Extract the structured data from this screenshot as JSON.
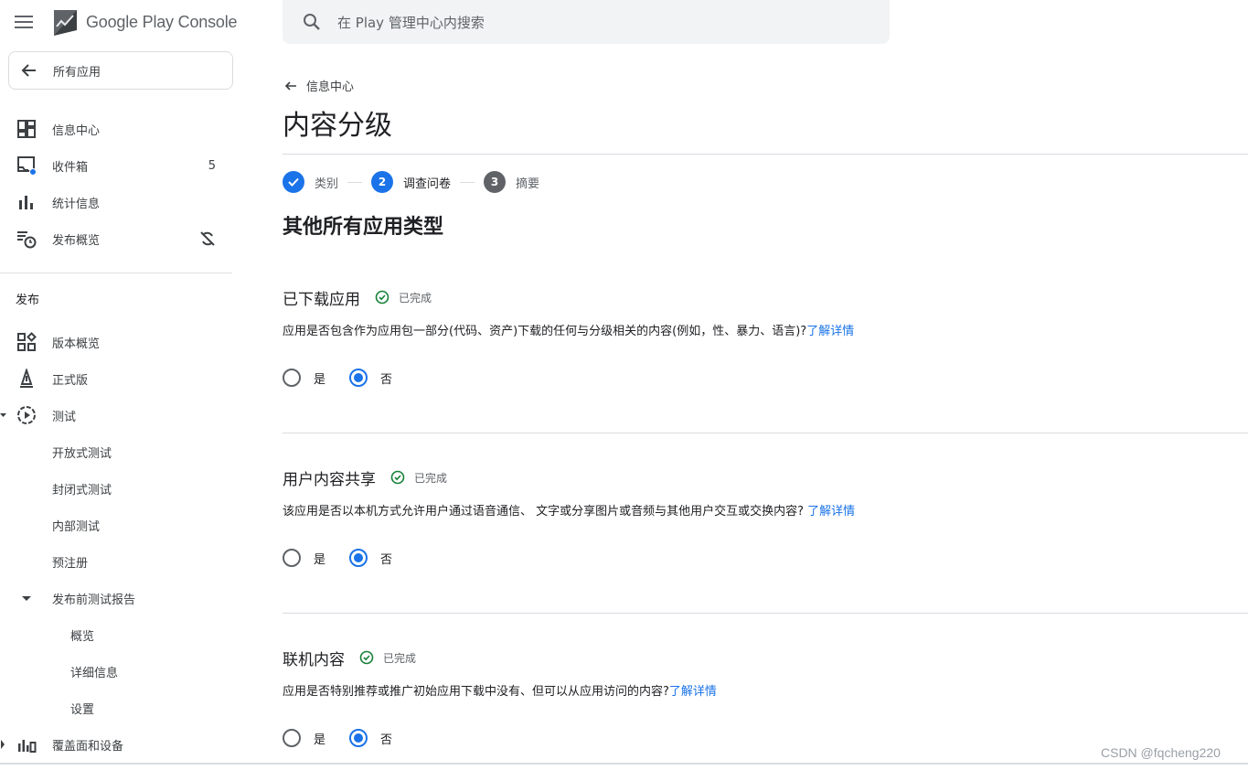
{
  "brand": {
    "name": "Google Play Console"
  },
  "sidebar": {
    "all_apps": "所有应用",
    "items": [
      {
        "label": "信息中心"
      },
      {
        "label": "收件箱",
        "badge": "5"
      },
      {
        "label": "统计信息"
      },
      {
        "label": "发布概览"
      }
    ],
    "section_title": "发布",
    "release_items": [
      {
        "label": "版本概览"
      },
      {
        "label": "正式版"
      },
      {
        "label": "测试"
      },
      {
        "label": "开放式测试"
      },
      {
        "label": "封闭式测试"
      },
      {
        "label": "内部测试"
      },
      {
        "label": "预注册"
      },
      {
        "label": "发布前测试报告"
      },
      {
        "label": "概览"
      },
      {
        "label": "详细信息"
      },
      {
        "label": "设置"
      },
      {
        "label": "覆盖面和设备"
      }
    ]
  },
  "search": {
    "placeholder": "在 Play 管理中心内搜索"
  },
  "main": {
    "back_label": "信息中心",
    "page_title": "内容分级",
    "steps": [
      {
        "label": "类别",
        "number": "",
        "state": "done"
      },
      {
        "label": "调查问卷",
        "number": "2",
        "state": "active"
      },
      {
        "label": "摘要",
        "number": "3",
        "state": "pending"
      }
    ],
    "category_title": "其他所有应用类型",
    "questions": [
      {
        "title": "已下载应用",
        "status": "已完成",
        "text": "应用是否包含作为应用包一部分(代码、资产)下载的任何与分级相关的内容(例如，性、暴力、语言)?",
        "link": "了解详情",
        "options": [
          "是",
          "否"
        ],
        "selected": "否"
      },
      {
        "title": "用户内容共享",
        "status": "已完成",
        "text": "该应用是否以本机方式允许用户通过语音通信、 文字或分享图片或音频与其他用户交互或交换内容? ",
        "link": "了解详情",
        "options": [
          "是",
          "否"
        ],
        "selected": "否"
      },
      {
        "title": "联机内容",
        "status": "已完成",
        "text": "应用是否特别推荐或推广初始应用下载中没有、但可以从应用访问的内容?",
        "link": "了解详情",
        "options": [
          "是",
          "否"
        ],
        "selected": "否"
      }
    ]
  },
  "watermark": "CSDN @fqcheng220",
  "colors": {
    "accent": "#1a73e8",
    "success": "#188038",
    "text": "#202124",
    "muted": "#5f6368"
  }
}
